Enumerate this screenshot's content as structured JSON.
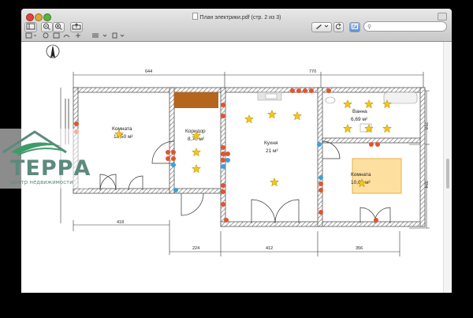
{
  "window": {
    "title": "План электрики.pdf (стр. 2 из 3)",
    "search_placeholder": ""
  },
  "plan": {
    "dimensions": {
      "top_left": "644",
      "top_right": "770",
      "bottom_left": "418",
      "bottom_1": "224",
      "bottom_2": "412",
      "bottom_3": "356",
      "right_top": "218",
      "right_bottom": "324"
    },
    "rooms": [
      {
        "name": "Комната",
        "area": "16,50 м²"
      },
      {
        "name": "Коридор",
        "area": "8,70 м²"
      },
      {
        "name": "Кухня",
        "area": "21 м²"
      },
      {
        "name": "Ванна",
        "area": "6,69 м²"
      },
      {
        "name": "Комната",
        "area": "10,00 м²"
      }
    ]
  },
  "watermark": {
    "brand": "ТЕРРА",
    "tagline": "центр недвижимости"
  },
  "colors": {
    "wall": "#666666",
    "star": "#f5c518",
    "red_socket": "#e0552f",
    "blue_socket": "#3aa0dc",
    "wardrobe": "#b5651d",
    "highlight": "#fde0a0",
    "logo": "#5c8a7d"
  }
}
